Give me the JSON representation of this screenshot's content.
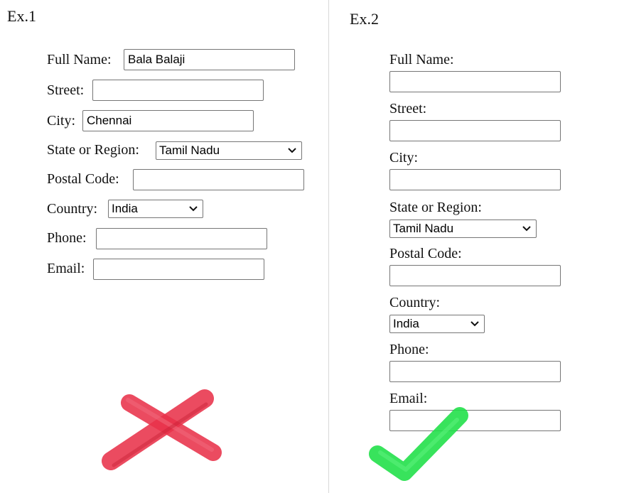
{
  "ex1": {
    "title": "Ex.1",
    "full_name_label": "Full Name:",
    "full_name_value": "Bala Balaji",
    "street_label": "Street:",
    "street_value": "",
    "city_label": "City:",
    "city_value": "Chennai",
    "state_label": "State or Region:",
    "state_value": "Tamil Nadu",
    "postal_label": "Postal Code:",
    "postal_value": "",
    "country_label": "Country:",
    "country_value": "India",
    "phone_label": "Phone:",
    "phone_value": "",
    "email_label": "Email:",
    "email_value": "",
    "verdict_icon": "red-cross-icon",
    "verdict_color": "#e8324a"
  },
  "ex2": {
    "title": "Ex.2",
    "full_name_label": "Full Name:",
    "full_name_value": "",
    "street_label": "Street:",
    "street_value": "",
    "city_label": "City:",
    "city_value": "",
    "state_label": "State or Region:",
    "state_value": "Tamil Nadu",
    "postal_label": "Postal Code:",
    "postal_value": "",
    "country_label": "Country:",
    "country_value": "India",
    "phone_label": "Phone:",
    "phone_value": "",
    "email_label": "Email:",
    "email_value": "",
    "verdict_icon": "green-checkmark-icon",
    "verdict_color": "#22e04a"
  }
}
